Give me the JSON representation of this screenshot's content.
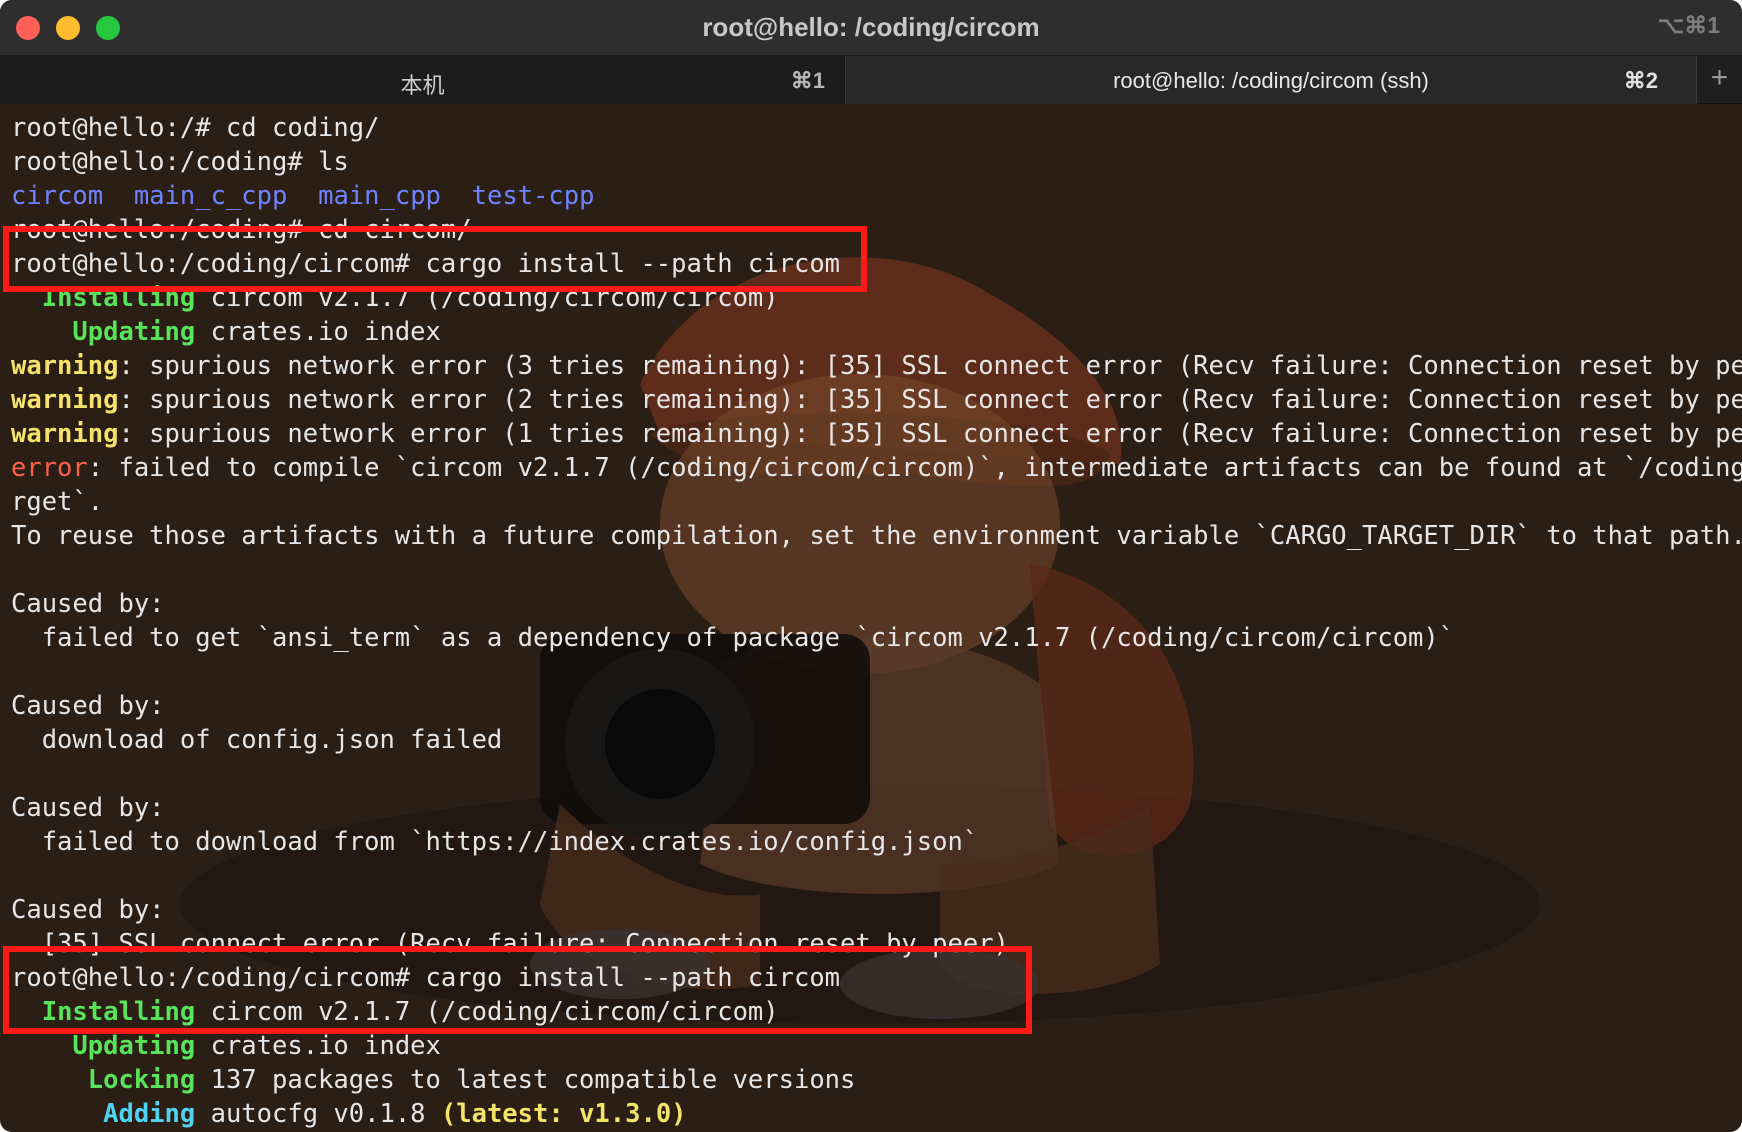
{
  "window": {
    "title": "root@hello: /coding/circom",
    "shortcut": "⌥⌘1"
  },
  "tabs": [
    {
      "label": "本机",
      "shortcut": "⌘1"
    },
    {
      "label": "root@hello: /coding/circom (ssh)",
      "shortcut": "⌘2"
    }
  ],
  "new_tab_label": "+",
  "terminal": {
    "lines": [
      {
        "segments": [
          {
            "text": "root@hello:/# cd coding/"
          }
        ]
      },
      {
        "segments": [
          {
            "text": "root@hello:/coding# ls"
          }
        ]
      },
      {
        "segments": [
          {
            "text": "circom",
            "color": "dir"
          },
          {
            "text": "  "
          },
          {
            "text": "main_c_cpp",
            "color": "dir"
          },
          {
            "text": "  "
          },
          {
            "text": "main_cpp",
            "color": "dir"
          },
          {
            "text": "  "
          },
          {
            "text": "test-cpp",
            "color": "dir"
          }
        ]
      },
      {
        "segments": [
          {
            "text": "root@hello:/coding# cd circom/"
          }
        ]
      },
      {
        "segments": [
          {
            "text": "root@hello:/coding/circom# cargo install --path circom"
          }
        ]
      },
      {
        "segments": [
          {
            "text": "  "
          },
          {
            "text": "Installing",
            "color": "green"
          },
          {
            "text": " circom v2.1.7 (/coding/circom/circom)"
          }
        ]
      },
      {
        "segments": [
          {
            "text": "    "
          },
          {
            "text": "Updating",
            "color": "green"
          },
          {
            "text": " crates.io index"
          }
        ]
      },
      {
        "segments": [
          {
            "text": "warning",
            "color": "warn"
          },
          {
            "text": ": spurious network error (3 tries remaining): [35] SSL connect error (Recv failure: Connection reset by peer)"
          }
        ]
      },
      {
        "segments": [
          {
            "text": "warning",
            "color": "warn"
          },
          {
            "text": ": spurious network error (2 tries remaining): [35] SSL connect error (Recv failure: Connection reset by peer)"
          }
        ]
      },
      {
        "segments": [
          {
            "text": "warning",
            "color": "warn"
          },
          {
            "text": ": spurious network error (1 tries remaining): [35] SSL connect error (Recv failure: Connection reset by peer)"
          }
        ]
      },
      {
        "segments": [
          {
            "text": "error",
            "color": "err"
          },
          {
            "text": ": failed to compile `circom v2.1.7 (/coding/circom/circom)`, intermediate artifacts can be found at `/coding/circom/ta"
          }
        ]
      },
      {
        "segments": [
          {
            "text": "rget`."
          }
        ]
      },
      {
        "segments": [
          {
            "text": "To reuse those artifacts with a future compilation, set the environment variable `CARGO_TARGET_DIR` to that path."
          }
        ]
      },
      {
        "segments": [
          {
            "text": ""
          }
        ]
      },
      {
        "segments": [
          {
            "text": "Caused by:"
          }
        ]
      },
      {
        "segments": [
          {
            "text": "  failed to get `ansi_term` as a dependency of package `circom v2.1.7 (/coding/circom/circom)`"
          }
        ]
      },
      {
        "segments": [
          {
            "text": ""
          }
        ]
      },
      {
        "segments": [
          {
            "text": "Caused by:"
          }
        ]
      },
      {
        "segments": [
          {
            "text": "  download of config.json failed"
          }
        ]
      },
      {
        "segments": [
          {
            "text": ""
          }
        ]
      },
      {
        "segments": [
          {
            "text": "Caused by:"
          }
        ]
      },
      {
        "segments": [
          {
            "text": "  failed to download from `https://index.crates.io/config.json`"
          }
        ]
      },
      {
        "segments": [
          {
            "text": ""
          }
        ]
      },
      {
        "segments": [
          {
            "text": "Caused by:"
          }
        ]
      },
      {
        "segments": [
          {
            "text": "  [35] SSL connect error (Recv failure: Connection reset by peer)"
          }
        ]
      },
      {
        "segments": [
          {
            "text": "root@hello:/coding/circom# cargo install --path circom"
          }
        ]
      },
      {
        "segments": [
          {
            "text": "  "
          },
          {
            "text": "Installing",
            "color": "green"
          },
          {
            "text": " circom v2.1.7 (/coding/circom/circom)"
          }
        ]
      },
      {
        "segments": [
          {
            "text": "    "
          },
          {
            "text": "Updating",
            "color": "green"
          },
          {
            "text": " crates.io index"
          }
        ]
      },
      {
        "segments": [
          {
            "text": "     "
          },
          {
            "text": "Locking",
            "color": "green"
          },
          {
            "text": " 137 packages to latest compatible versions"
          }
        ]
      },
      {
        "segments": [
          {
            "text": "      "
          },
          {
            "text": "Adding",
            "color": "cyan"
          },
          {
            "text": " autocfg v0.1.8 "
          },
          {
            "text": "(latest: v1.3.0)",
            "color": "yellow"
          }
        ]
      }
    ]
  },
  "colors": {
    "highlight_box": "#ff1a1a",
    "dir": "#6e83ff",
    "warning": "#f4e26a",
    "error": "#ff5e4d",
    "success": "#58e35a",
    "info": "#50d2f0"
  },
  "background_art": "cartoon-photographer-illustration"
}
